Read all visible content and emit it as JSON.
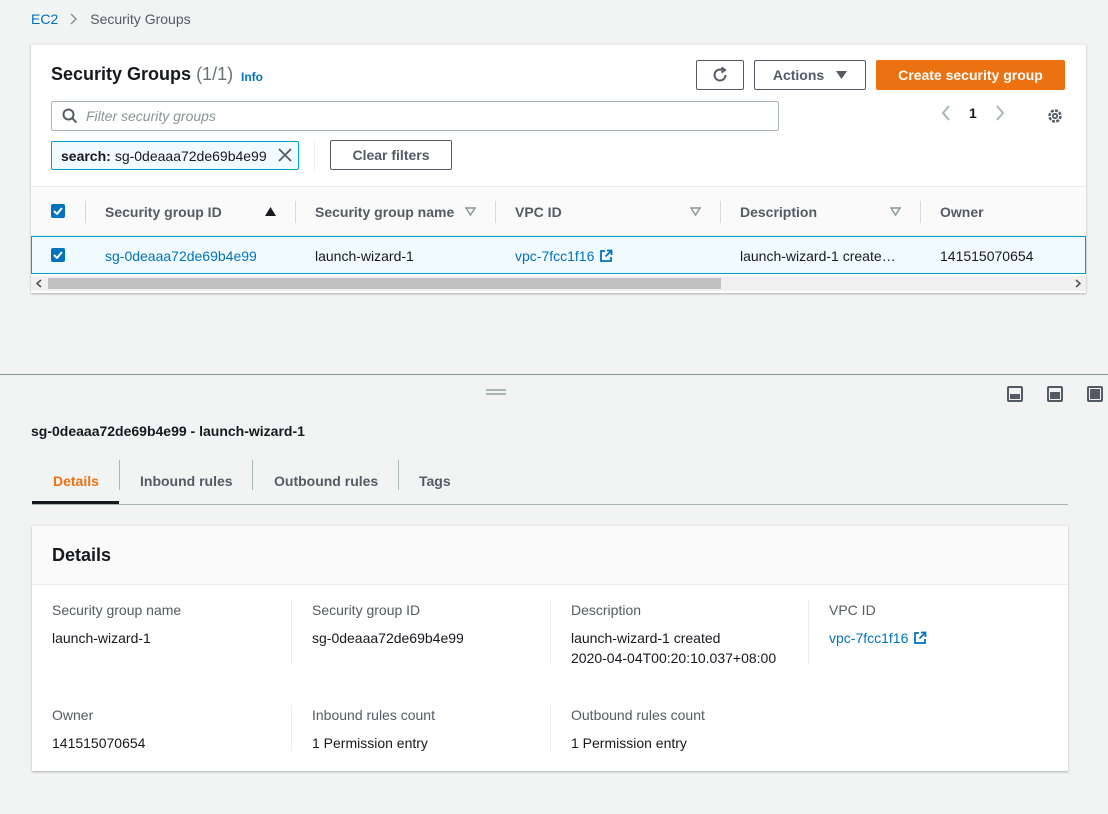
{
  "breadcrumb": {
    "root": "EC2",
    "current": "Security Groups"
  },
  "panel": {
    "title": "Security Groups",
    "count": "(1/1)",
    "info": "Info",
    "actions_label": "Actions",
    "create_label": "Create security group",
    "search_placeholder": "Filter security groups",
    "page": "1",
    "token_key": "search:",
    "token_value": "sg-0deaaa72de69b4e99",
    "clear_filters": "Clear filters"
  },
  "table": {
    "columns": [
      "Security group ID",
      "Security group name",
      "VPC ID",
      "Description",
      "Owner"
    ],
    "rows": [
      {
        "id": "sg-0deaaa72de69b4e99",
        "name": "launch-wizard-1",
        "vpc": "vpc-7fcc1f16",
        "description": "launch-wizard-1 create…",
        "owner": "141515070654",
        "selected": true
      }
    ]
  },
  "split": {
    "title": "sg-0deaaa72de69b4e99 - launch-wizard-1",
    "tabs": [
      "Details",
      "Inbound rules",
      "Outbound rules",
      "Tags"
    ],
    "active_tab": "Details",
    "details": {
      "heading": "Details",
      "sg_name_label": "Security group name",
      "sg_name": "launch-wizard-1",
      "sg_id_label": "Security group ID",
      "sg_id": "sg-0deaaa72de69b4e99",
      "description_label": "Description",
      "description_line1": "launch-wizard-1 created",
      "description_line2": "2020-04-04T00:20:10.037+08:00",
      "vpc_label": "VPC ID",
      "vpc": "vpc-7fcc1f16",
      "owner_label": "Owner",
      "owner": "141515070654",
      "inbound_label": "Inbound rules count",
      "inbound": "1 Permission entry",
      "outbound_label": "Outbound rules count",
      "outbound": "1 Permission entry"
    }
  },
  "colors": {
    "link": "#0073bb",
    "primary": "#ec7211",
    "selected_bg": "#f1faff",
    "selected_border": "#00a1c9"
  }
}
